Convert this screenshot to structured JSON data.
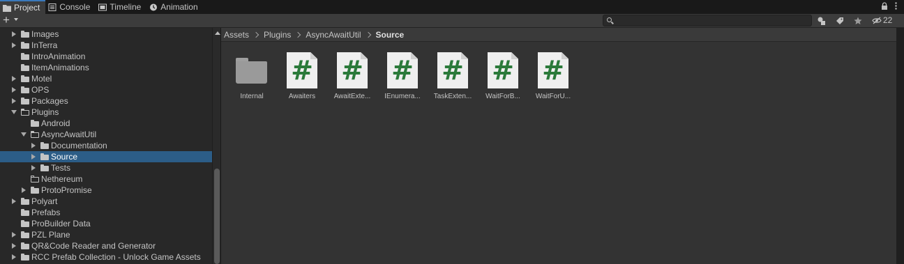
{
  "tabs": [
    {
      "label": "Project",
      "icon": "folder-icon",
      "active": true
    },
    {
      "label": "Console",
      "icon": "console-icon",
      "active": false
    },
    {
      "label": "Timeline",
      "icon": "timeline-icon",
      "active": false
    },
    {
      "label": "Animation",
      "icon": "animation-icon",
      "active": false
    }
  ],
  "toolbar": {
    "create_label": "+",
    "search_placeholder": "",
    "hidden_count": "22"
  },
  "tree": [
    {
      "label": "Images",
      "expanded": false,
      "hasChildren": true,
      "depth": 0
    },
    {
      "label": "InTerra",
      "expanded": false,
      "hasChildren": true,
      "depth": 0
    },
    {
      "label": "IntroAnimation",
      "expanded": false,
      "hasChildren": false,
      "depth": 0
    },
    {
      "label": "ItemAnimations",
      "expanded": false,
      "hasChildren": false,
      "depth": 0
    },
    {
      "label": "Motel",
      "expanded": false,
      "hasChildren": true,
      "depth": 0
    },
    {
      "label": "OPS",
      "expanded": false,
      "hasChildren": true,
      "depth": 0
    },
    {
      "label": "Packages",
      "expanded": false,
      "hasChildren": true,
      "depth": 0
    },
    {
      "label": "Plugins",
      "expanded": true,
      "hasChildren": true,
      "depth": 0
    },
    {
      "label": "Android",
      "expanded": false,
      "hasChildren": false,
      "depth": 1
    },
    {
      "label": "AsyncAwaitUtil",
      "expanded": true,
      "hasChildren": true,
      "depth": 1
    },
    {
      "label": "Documentation",
      "expanded": false,
      "hasChildren": true,
      "depth": 2
    },
    {
      "label": "Source",
      "expanded": false,
      "hasChildren": true,
      "depth": 2,
      "selected": true
    },
    {
      "label": "Tests",
      "expanded": false,
      "hasChildren": true,
      "depth": 2
    },
    {
      "label": "Nethereum",
      "expanded": false,
      "hasChildren": false,
      "depth": 1,
      "empty": true
    },
    {
      "label": "ProtoPromise",
      "expanded": false,
      "hasChildren": true,
      "depth": 1
    },
    {
      "label": "Polyart",
      "expanded": false,
      "hasChildren": true,
      "depth": 0
    },
    {
      "label": "Prefabs",
      "expanded": false,
      "hasChildren": false,
      "depth": 0
    },
    {
      "label": "ProBuilder Data",
      "expanded": false,
      "hasChildren": false,
      "depth": 0
    },
    {
      "label": "PZL Plane",
      "expanded": false,
      "hasChildren": true,
      "depth": 0
    },
    {
      "label": "QR&Code Reader and Generator",
      "expanded": false,
      "hasChildren": true,
      "depth": 0
    },
    {
      "label": "RCC Prefab Collection - Unlock Game Assets",
      "expanded": false,
      "hasChildren": true,
      "depth": 0
    }
  ],
  "breadcrumb": [
    "Assets",
    "Plugins",
    "AsyncAwaitUtil",
    "Source"
  ],
  "items": [
    {
      "label": "Internal",
      "type": "folder"
    },
    {
      "label": "Awaiters",
      "type": "script"
    },
    {
      "label": "AwaitExte...",
      "type": "script"
    },
    {
      "label": "IEnumera...",
      "type": "script"
    },
    {
      "label": "TaskExten...",
      "type": "script"
    },
    {
      "label": "WaitForB...",
      "type": "script"
    },
    {
      "label": "WaitForU...",
      "type": "script"
    }
  ],
  "script_glyph": "#",
  "colors": {
    "selection": "#2c5d87",
    "script_hash": "#2b7a3a",
    "tab_active_accent": "#3a79bb"
  }
}
